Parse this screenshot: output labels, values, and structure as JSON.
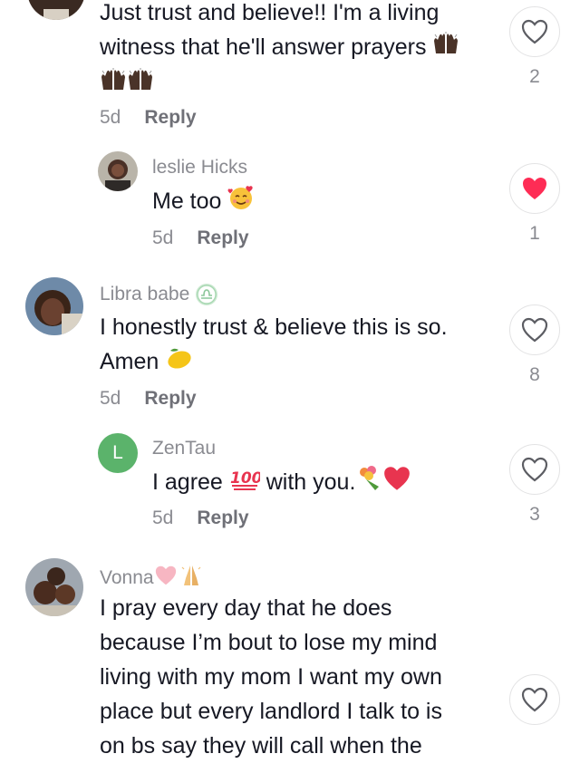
{
  "comments": [
    {
      "text_line1": "Just trust and believe!! I'm a living",
      "text_line2": "witness that he'll answer prayers",
      "time": "5d",
      "reply": "Reply",
      "likes": "2"
    },
    {
      "username": "leslie Hicks",
      "text": "Me too",
      "time": "5d",
      "reply": "Reply",
      "likes": "1"
    },
    {
      "username": "Libra babe",
      "text_line1": "I honestly trust & believe this is so.",
      "text_line2": "Amen",
      "time": "5d",
      "reply": "Reply",
      "likes": "8"
    },
    {
      "username": "ZenTau",
      "avatar_letter": "L",
      "text_before": "I agree",
      "text_after": "with you.",
      "time": "5d",
      "reply": "Reply",
      "likes": "3"
    },
    {
      "username": "Vonna",
      "lines": [
        "I pray every day that he does",
        "because I’m bout to lose my mind",
        "living with my mom I want my own",
        "place but every landlord I talk to is",
        "on bs say they will call when the"
      ]
    }
  ],
  "colors": {
    "liked_heart": "#fe2c55",
    "avatar_green": "#5bb36b"
  },
  "icons": [
    "heart-outline-icon",
    "heart-filled-icon",
    "libra-badge-icon",
    "raising-hands-emoji",
    "smiling-hearts-emoji",
    "lemon-emoji",
    "hundred-emoji",
    "bouquet-emoji",
    "red-heart-emoji",
    "pink-heart-emoji",
    "folded-hands-emoji"
  ]
}
